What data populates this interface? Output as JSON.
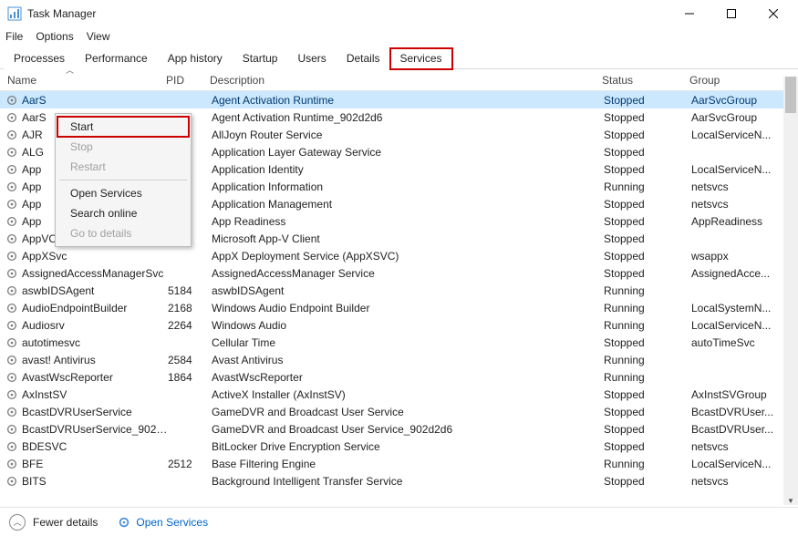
{
  "window": {
    "title": "Task Manager"
  },
  "menu": {
    "file": "File",
    "options": "Options",
    "view": "View"
  },
  "tabs": {
    "processes": "Processes",
    "performance": "Performance",
    "appHistory": "App history",
    "startup": "Startup",
    "users": "Users",
    "details": "Details",
    "services": "Services"
  },
  "columns": {
    "name": "Name",
    "pid": "PID",
    "description": "Description",
    "status": "Status",
    "group": "Group"
  },
  "context": {
    "start": "Start",
    "stop": "Stop",
    "restart": "Restart",
    "openServices": "Open Services",
    "searchOnline": "Search online",
    "goToDetails": "Go to details"
  },
  "footer": {
    "fewer": "Fewer details",
    "openServices": "Open Services"
  },
  "rows": [
    {
      "name": "AarS",
      "pid": "",
      "desc": "Agent Activation Runtime",
      "status": "Stopped",
      "group": "AarSvcGroup",
      "selected": true
    },
    {
      "name": "AarS",
      "pid": "",
      "desc": "Agent Activation Runtime_902d2d6",
      "status": "Stopped",
      "group": "AarSvcGroup"
    },
    {
      "name": "AJR",
      "pid": "",
      "desc": "AllJoyn Router Service",
      "status": "Stopped",
      "group": "LocalServiceN..."
    },
    {
      "name": "ALG",
      "pid": "",
      "desc": "Application Layer Gateway Service",
      "status": "Stopped",
      "group": ""
    },
    {
      "name": "App",
      "pid": "",
      "desc": "Application Identity",
      "status": "Stopped",
      "group": "LocalServiceN..."
    },
    {
      "name": "App",
      "pid": "",
      "desc": "Application Information",
      "status": "Running",
      "group": "netsvcs"
    },
    {
      "name": "App",
      "pid": "",
      "desc": "Application Management",
      "status": "Stopped",
      "group": "netsvcs"
    },
    {
      "name": "App",
      "pid": "",
      "desc": "App Readiness",
      "status": "Stopped",
      "group": "AppReadiness"
    },
    {
      "name": "AppVClient",
      "pid": "",
      "desc": "Microsoft App-V Client",
      "status": "Stopped",
      "group": ""
    },
    {
      "name": "AppXSvc",
      "pid": "",
      "desc": "AppX Deployment Service (AppXSVC)",
      "status": "Stopped",
      "group": "wsappx"
    },
    {
      "name": "AssignedAccessManagerSvc",
      "pid": "",
      "desc": "AssignedAccessManager Service",
      "status": "Stopped",
      "group": "AssignedAcce..."
    },
    {
      "name": "aswbIDSAgent",
      "pid": "5184",
      "desc": "aswbIDSAgent",
      "status": "Running",
      "group": ""
    },
    {
      "name": "AudioEndpointBuilder",
      "pid": "2168",
      "desc": "Windows Audio Endpoint Builder",
      "status": "Running",
      "group": "LocalSystemN..."
    },
    {
      "name": "Audiosrv",
      "pid": "2264",
      "desc": "Windows Audio",
      "status": "Running",
      "group": "LocalServiceN..."
    },
    {
      "name": "autotimesvc",
      "pid": "",
      "desc": "Cellular Time",
      "status": "Stopped",
      "group": "autoTimeSvc"
    },
    {
      "name": "avast! Antivirus",
      "pid": "2584",
      "desc": "Avast Antivirus",
      "status": "Running",
      "group": ""
    },
    {
      "name": "AvastWscReporter",
      "pid": "1864",
      "desc": "AvastWscReporter",
      "status": "Running",
      "group": ""
    },
    {
      "name": "AxInstSV",
      "pid": "",
      "desc": "ActiveX Installer (AxInstSV)",
      "status": "Stopped",
      "group": "AxInstSVGroup"
    },
    {
      "name": "BcastDVRUserService",
      "pid": "",
      "desc": "GameDVR and Broadcast User Service",
      "status": "Stopped",
      "group": "BcastDVRUser..."
    },
    {
      "name": "BcastDVRUserService_902d...",
      "pid": "",
      "desc": "GameDVR and Broadcast User Service_902d2d6",
      "status": "Stopped",
      "group": "BcastDVRUser..."
    },
    {
      "name": "BDESVC",
      "pid": "",
      "desc": "BitLocker Drive Encryption Service",
      "status": "Stopped",
      "group": "netsvcs"
    },
    {
      "name": "BFE",
      "pid": "2512",
      "desc": "Base Filtering Engine",
      "status": "Running",
      "group": "LocalServiceN..."
    },
    {
      "name": "BITS",
      "pid": "",
      "desc": "Background Intelligent Transfer Service",
      "status": "Stopped",
      "group": "netsvcs"
    }
  ]
}
